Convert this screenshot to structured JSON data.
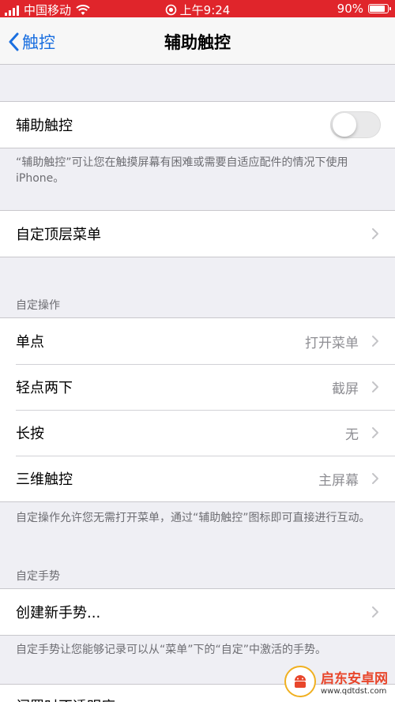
{
  "status_bar": {
    "carrier": "中国移动",
    "time": "上午9:24",
    "battery": "90%",
    "battery_level": 0.9
  },
  "nav": {
    "back_label": "触控",
    "title": "辅助触控"
  },
  "main_toggle": {
    "label": "辅助触控",
    "enabled": false,
    "footer": "“辅助触控”可让您在触摸屏幕有困难或需要自适应配件的情况下使用iPhone。"
  },
  "top_menu": {
    "label": "自定顶层菜单"
  },
  "custom_actions": {
    "header": "自定操作",
    "items": [
      {
        "label": "单点",
        "value": "打开菜单"
      },
      {
        "label": "轻点两下",
        "value": "截屏"
      },
      {
        "label": "长按",
        "value": "无"
      },
      {
        "label": "三维触控",
        "value": "主屏幕"
      }
    ],
    "footer": "自定操作允许您无需打开菜单，通过“辅助触控”图标即可直接进行互动。"
  },
  "custom_gestures": {
    "header": "自定手势",
    "create_label": "创建新手势...",
    "footer": "自定手势让您能够记录可以从“菜单”下的“自定”中激活的手势。"
  },
  "next_row_label": "闲置时不透明度",
  "watermark": {
    "name": "启东安卓网",
    "url": "www.qdtdst.com"
  },
  "colors": {
    "status_bar": "#e0252b",
    "accent": "#1a6fe0",
    "background": "#efeff4"
  }
}
